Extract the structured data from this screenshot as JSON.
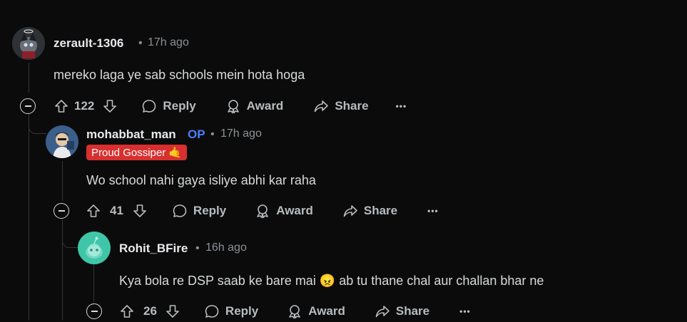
{
  "comments": [
    {
      "username": "zerault-1306",
      "time": "17h ago",
      "text": "mereko laga ye sab schools mein hota hoga",
      "votes": "122",
      "reply": "Reply",
      "award": "Award",
      "share": "Share",
      "more": "•••"
    },
    {
      "username": "mohabbat_man",
      "op": "OP",
      "time": "17h ago",
      "flair": "Proud Gossiper 🤙",
      "text": "Wo school nahi gaya isliye abhi kar raha",
      "votes": "41",
      "reply": "Reply",
      "award": "Award",
      "share": "Share",
      "more": "•••"
    },
    {
      "username": "Rohit_BFire",
      "time": "16h ago",
      "text": "Kya bola re DSP saab ke bare mai 😠 ab tu thane chal aur challan bhar ne",
      "votes": "26",
      "reply": "Reply",
      "award": "Award",
      "share": "Share",
      "more": "•••"
    }
  ],
  "separator": "•"
}
